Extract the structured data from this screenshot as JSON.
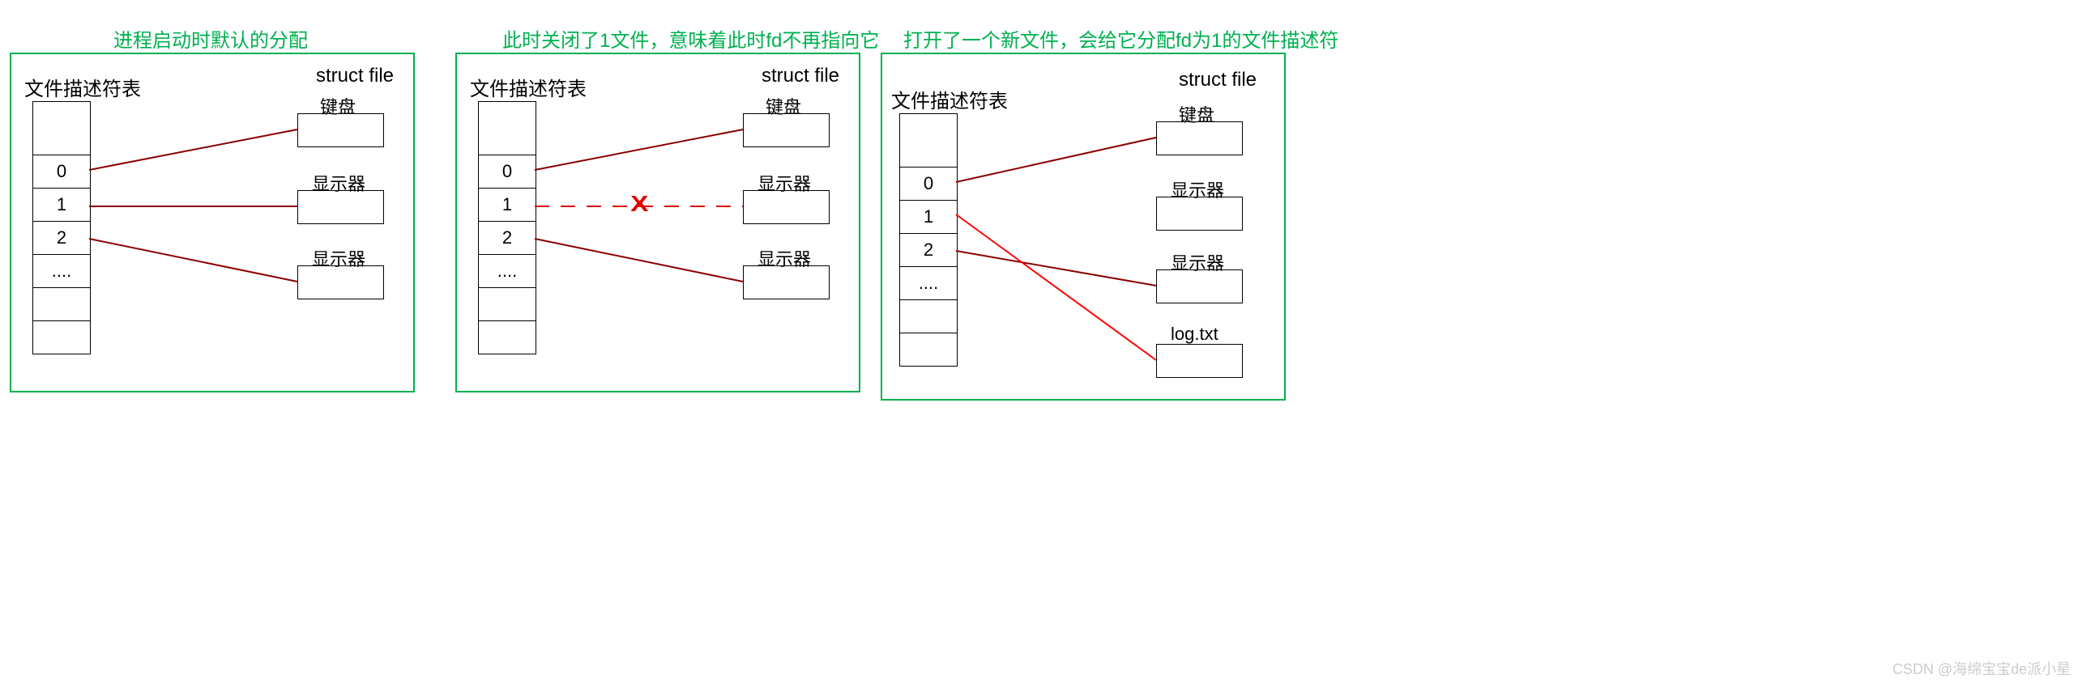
{
  "titles": {
    "p1": "进程启动时默认的分配",
    "p2": "此时关闭了1文件，意味着此时fd不再指向它",
    "p3": "打开了一个新文件，会给它分配fd为1的文件描述符"
  },
  "labels": {
    "fdTable": "文件描述符表",
    "structFile": "struct file"
  },
  "fdEntries": [
    "0",
    "1",
    "2",
    "...."
  ],
  "files": {
    "kbd": "键盘",
    "mon": "显示器",
    "log": "log.txt"
  },
  "watermark": "CSDN @海绵宝宝de派小星",
  "xMark": "X"
}
